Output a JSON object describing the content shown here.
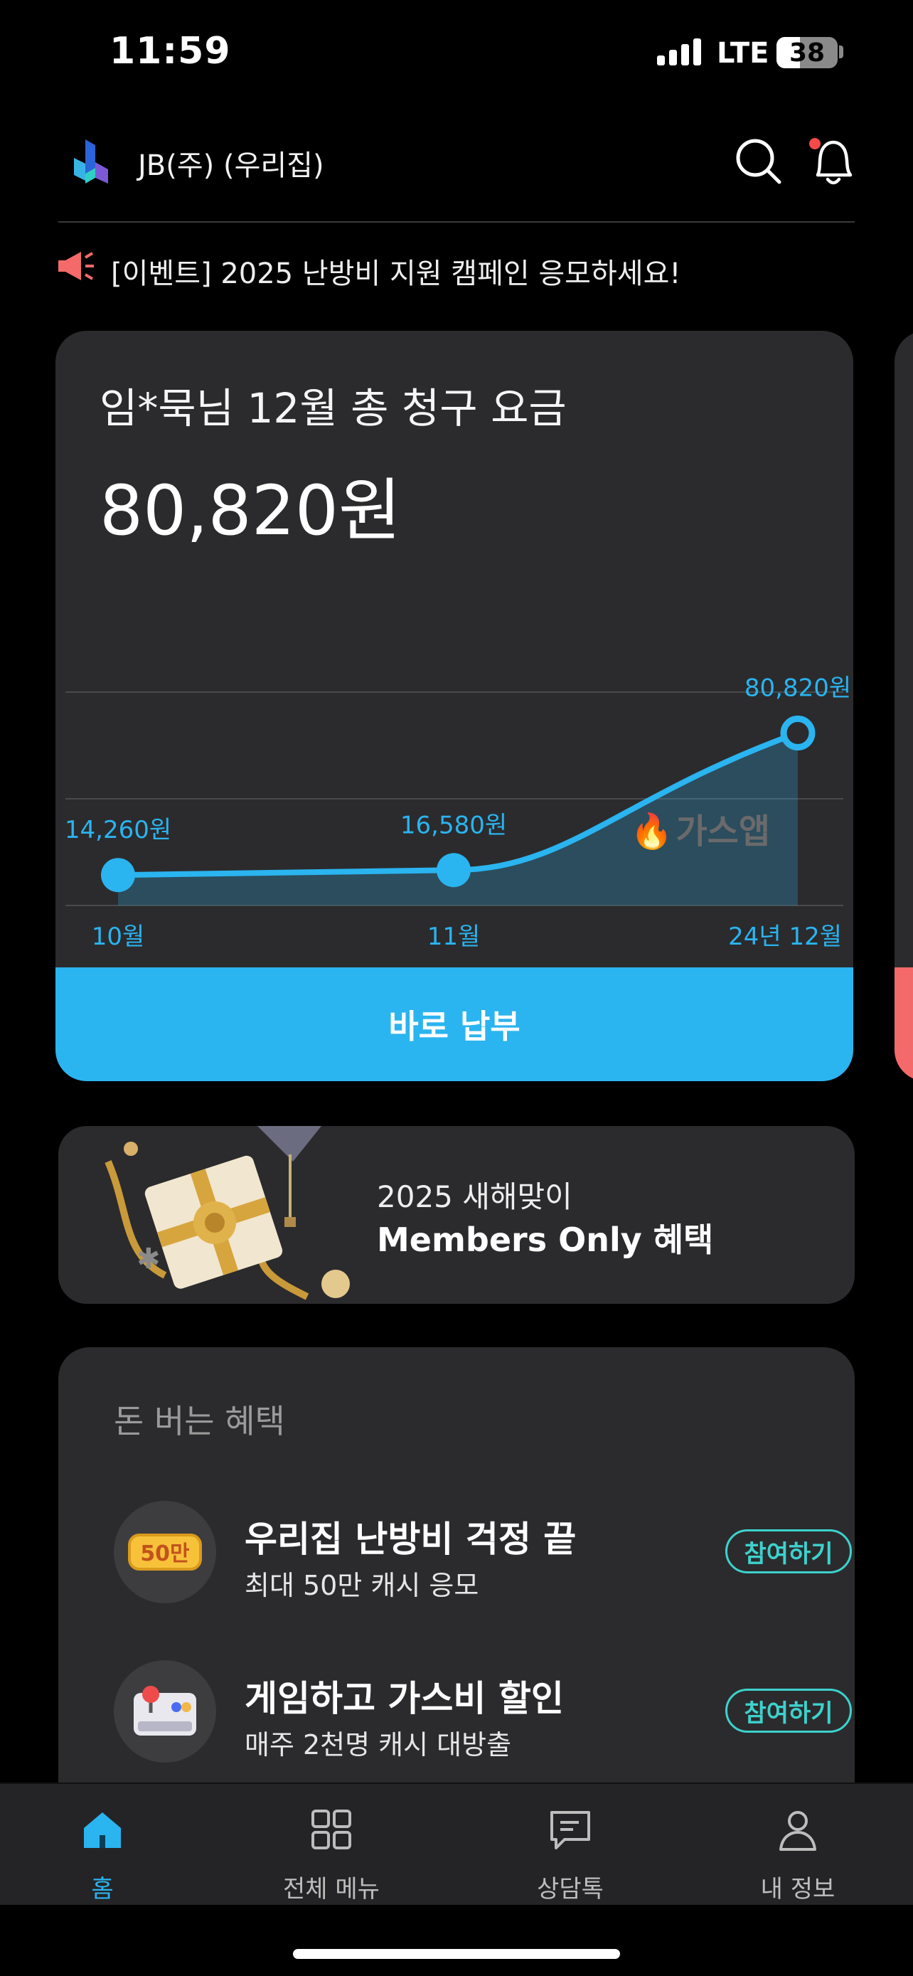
{
  "status": {
    "time": "11:59",
    "network": "LTE",
    "battery": "38"
  },
  "header": {
    "title": "JB(주)  (우리집)"
  },
  "notice": {
    "text": "[이벤트] 2025 난방비 지원 캠페인 응모하세요!"
  },
  "bill": {
    "title": "임*묵님 12월 총 청구 요금",
    "amount": "80,820원",
    "pay_label": "바로 납부",
    "watermark": "가스앱"
  },
  "chart_data": {
    "type": "area",
    "categories": [
      "10월",
      "11월",
      "24년 12월"
    ],
    "values": [
      14260,
      16580,
      80820
    ],
    "data_labels": [
      "14,260원",
      "16,580원",
      "80,820원"
    ],
    "ylim": [
      0,
      100000
    ],
    "grid": true,
    "color": "#2ab4f0"
  },
  "banner": {
    "line1": "2025 새해맞이",
    "line2": "Members Only 혜택"
  },
  "benefits": {
    "title": "돈 버는 혜택",
    "items": [
      {
        "icon": "coin-50-icon",
        "badge": "50만",
        "title": "우리집 난방비 걱정 끝",
        "subtitle": "최대 50만 캐시 응모",
        "button": "참여하기"
      },
      {
        "icon": "game-controller-icon",
        "title": "게임하고 가스비 할인",
        "subtitle": "매주 2천명 캐시 대방출",
        "button": "참여하기"
      }
    ]
  },
  "tabs": [
    {
      "label": "홈",
      "icon": "home-icon",
      "active": true
    },
    {
      "label": "전체 메뉴",
      "icon": "grid-icon",
      "active": false
    },
    {
      "label": "상담톡",
      "icon": "chat-icon",
      "active": false
    },
    {
      "label": "내 정보",
      "icon": "person-icon",
      "active": false
    }
  ],
  "colors": {
    "accent": "#2ab4f0",
    "teal": "#3dd2cd",
    "card": "#2b2b2d",
    "alert": "#f46a6a"
  }
}
